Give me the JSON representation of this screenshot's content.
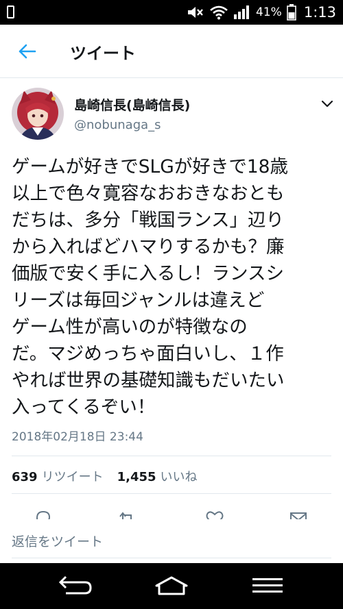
{
  "status_bar": {
    "battery_percent": "41%",
    "time": "1:13",
    "icons": [
      "phone-icon",
      "mute-icon",
      "wifi-icon",
      "signal-icon",
      "battery-icon"
    ]
  },
  "header": {
    "title": "ツイート",
    "back_icon": "arrow-left-icon"
  },
  "tweet": {
    "display_name": "島崎信長(島崎信長)",
    "handle": "@nobunaga_s",
    "text": "ゲームが好きでSLGが好きで18歳\n以上で色々寛容なおおきなおとも\nだちは、多分「戦国ランス」辺り\nから入ればどハマりするかも？廉\n価版で安く手に入るし！ランスシ\nリーズは毎回ジャンルは違えど\nゲーム性が高いのが特徴なの\nだ。マジめっちゃ面白いし、１作\nやれば世界の基礎知識もだいたい\n入ってくるぞい！",
    "timestamp": "2018年02月18日 23:44",
    "retweet_count": "639",
    "retweet_label": "リツイート",
    "like_count": "1,455",
    "like_label": "いいね"
  },
  "reply": {
    "placeholder": "返信をツイート"
  },
  "colors": {
    "accent": "#1da1f2",
    "text": "#14171a",
    "secondary_text": "#657786",
    "divider": "#e1e8ed"
  }
}
